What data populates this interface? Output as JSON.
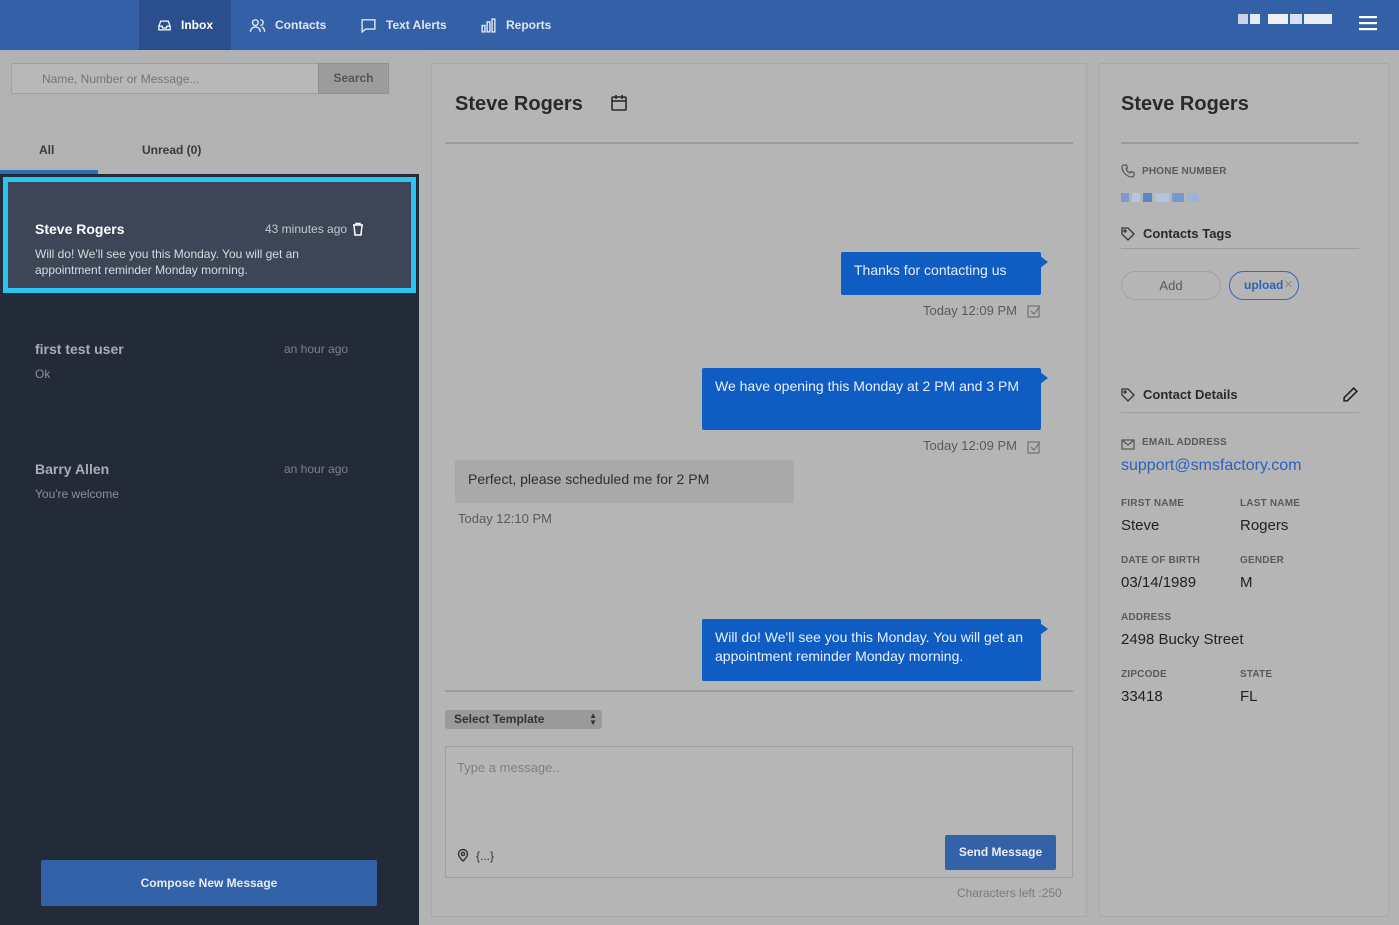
{
  "nav": {
    "items": [
      {
        "label": "Inbox",
        "icon": "inbox-icon",
        "active": true
      },
      {
        "label": "Contacts",
        "icon": "contacts-icon",
        "active": false
      },
      {
        "label": "Text Alerts",
        "icon": "chat-bubble-icon",
        "active": false
      },
      {
        "label": "Reports",
        "icon": "bar-chart-icon",
        "active": false
      }
    ],
    "menu_icon": "hamburger-menu-icon"
  },
  "search": {
    "placeholder": "Name, Number or Message...",
    "button_label": "Search"
  },
  "tabs": [
    {
      "label": "All",
      "active": true
    },
    {
      "label": "Unread (0)",
      "active": false
    }
  ],
  "conversations": [
    {
      "name": "Steve Rogers",
      "time": "43 minutes ago",
      "preview": "Will do! We'll see you this Monday. You will get an appointment reminder Monday morning.",
      "selected": true
    },
    {
      "name": "first test user",
      "time": "an hour ago",
      "preview": "Ok",
      "selected": false
    },
    {
      "name": "Barry Allen",
      "time": "an hour ago",
      "preview": "You're welcome",
      "selected": false
    }
  ],
  "compose_label": "Compose New Message",
  "chat": {
    "title": "Steve Rogers",
    "messages": [
      {
        "direction": "out",
        "text": "Thanks for contacting us",
        "time": "Today 12:09 PM"
      },
      {
        "direction": "out",
        "text": "We have opening this Monday at 2 PM and 3 PM",
        "time": "Today 12:09 PM"
      },
      {
        "direction": "in",
        "text": "Perfect, please scheduled me for 2 PM",
        "time": "Today 12:10 PM"
      },
      {
        "direction": "out",
        "text": "Will do! We'll see you this Monday. You will get an appointment reminder Monday morning.",
        "time": ""
      }
    ],
    "select_template": "Select Template",
    "message_placeholder": "Type a message..",
    "variables_label": "{...}",
    "send_label": "Send Message",
    "chars_left": "Characters left :250"
  },
  "contact": {
    "name": "Steve Rogers",
    "phone_label": "PHONE NUMBER",
    "tags_title": "Contacts Tags",
    "tag_add_label": "Add",
    "tags": [
      "upload"
    ],
    "details_title": "Contact Details",
    "email_label": "EMAIL ADDRESS",
    "email": "support@smsfactory.com",
    "first_name_label": "FIRST NAME",
    "first_name": "Steve",
    "last_name_label": "LAST NAME",
    "last_name": "Rogers",
    "dob_label": "DATE OF BIRTH",
    "dob": "03/14/1989",
    "gender_label": "GENDER",
    "gender": "M",
    "address_label": "ADDRESS",
    "address": "2498 Bucky Street",
    "zipcode_label": "ZIPCODE",
    "zipcode": "33418",
    "state_label": "STATE",
    "state": "FL"
  },
  "colors": {
    "nav_bg": "#3360a6",
    "sidebar_bg": "#232a38",
    "selected_border": "#29c4ef",
    "outgoing_bubble": "#0f5dc2",
    "primary_button": "#3462a8"
  }
}
